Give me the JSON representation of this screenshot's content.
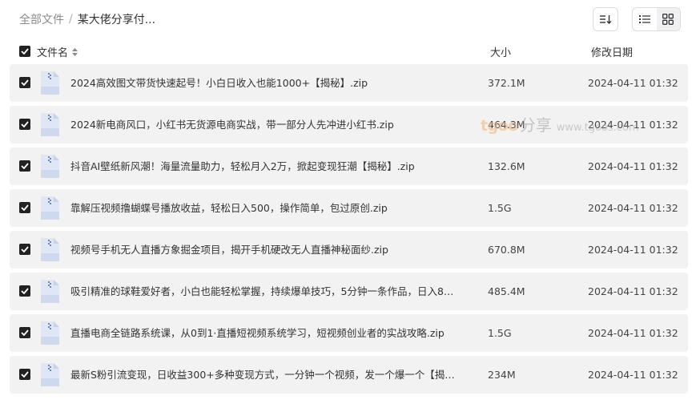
{
  "breadcrumb": {
    "root": "全部文件",
    "separator": "/",
    "current": "某大佬分享付..."
  },
  "header": {
    "name": "文件名",
    "size": "大小",
    "date": "修改日期"
  },
  "files": [
    {
      "name": "2024高效图文带货快速起号！小白日收入也能1000+【揭秘】.zip",
      "size": "372.1M",
      "date": "2024-04-11 01:32"
    },
    {
      "name": "2024新电商风口，小红书无货源电商实战，带一部分人先冲进小红书.zip",
      "size": "464.3M",
      "date": "2024-04-11 01:32"
    },
    {
      "name": "抖音AI壁纸新风潮！海量流量助力，轻松月入2万，掀起变现狂潮【揭秘】.zip",
      "size": "132.6M",
      "date": "2024-04-11 01:32"
    },
    {
      "name": "靠解压视频撸蝴蝶号播放收益，轻松日入500，操作简单，包过原创.zip",
      "size": "1.5G",
      "date": "2024-04-11 01:32"
    },
    {
      "name": "视频号手机无人直播方象掘金项目，揭开手机硬改无人直播神秘面纱.zip",
      "size": "670.8M",
      "date": "2024-04-11 01:32"
    },
    {
      "name": "吸引精准的球鞋爱好者，小白也能轻松掌握，持续爆单技巧，5分钟一条作品，日入800...",
      "size": "485.4M",
      "date": "2024-04-11 01:32"
    },
    {
      "name": "直播电商全链路系统课，从0到1·直播短视频系统学习，短视频创业者的实战攻略.zip",
      "size": "1.5G",
      "date": "2024-04-11 01:32"
    },
    {
      "name": "最新S粉引流变现，日收益300+多种变现方式，一分钟一个视频，发一个爆一个【揭秘...",
      "size": "234M",
      "date": "2024-04-11 01:32"
    }
  ],
  "watermark": {
    "brand": "tgoo",
    "share": "分享",
    "url": "www.tgoos.com"
  },
  "icons": {
    "sort": "sort-icon",
    "list_view": "list-view-icon",
    "grid_view": "grid-view-icon",
    "file": "zip-file-icon",
    "checkbox": "checkbox-checked-icon"
  },
  "colors": {
    "row_background": "#f2f2f2",
    "checkbox": "#222222",
    "file_icon": "#dfe6f5",
    "watermark_orange": "#f0b27a"
  }
}
